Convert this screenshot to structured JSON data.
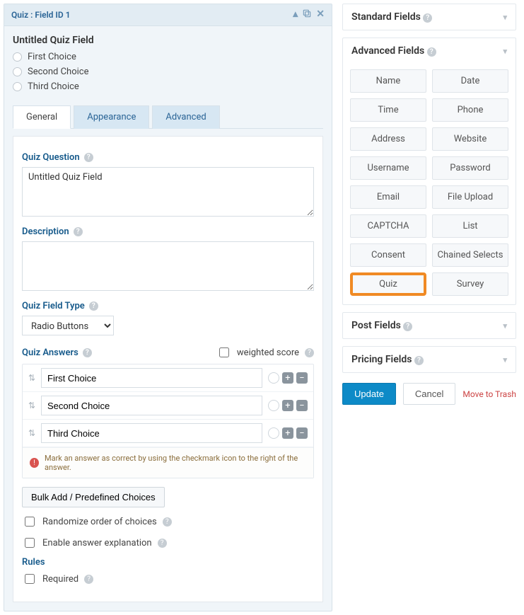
{
  "panel": {
    "title": "Quiz : Field ID 1"
  },
  "field": {
    "title": "Untitled Quiz Field",
    "choices": [
      "First Choice",
      "Second Choice",
      "Third Choice"
    ]
  },
  "tabs": {
    "general": "General",
    "appearance": "Appearance",
    "advanced": "Advanced"
  },
  "labels": {
    "quiz_question": "Quiz Question",
    "description": "Description",
    "quiz_field_type": "Quiz Field Type",
    "quiz_answers": "Quiz Answers",
    "weighted_score": "weighted score",
    "bulk_add": "Bulk Add / Predefined Choices",
    "randomize": "Randomize order of choices",
    "enable_expl": "Enable answer explanation",
    "rules": "Rules",
    "required": "Required",
    "answers_note": "Mark an answer as correct by using the checkmark icon to the right of the answer."
  },
  "values": {
    "quiz_question": "Untitled Quiz Field",
    "description": "",
    "field_type": "Radio Buttons",
    "answers": [
      "First Choice",
      "Second Choice",
      "Third Choice"
    ]
  },
  "sidebar": {
    "standard": {
      "title": "Standard Fields"
    },
    "advanced": {
      "title": "Advanced Fields",
      "items": [
        "Name",
        "Date",
        "Time",
        "Phone",
        "Address",
        "Website",
        "Username",
        "Password",
        "Email",
        "File Upload",
        "CAPTCHA",
        "List",
        "Consent",
        "Chained Selects",
        "Quiz",
        "Survey"
      ],
      "highlight_index": 14
    },
    "post": {
      "title": "Post Fields"
    },
    "pricing": {
      "title": "Pricing Fields"
    }
  },
  "actions": {
    "update": "Update",
    "cancel": "Cancel",
    "trash": "Move to Trash"
  }
}
